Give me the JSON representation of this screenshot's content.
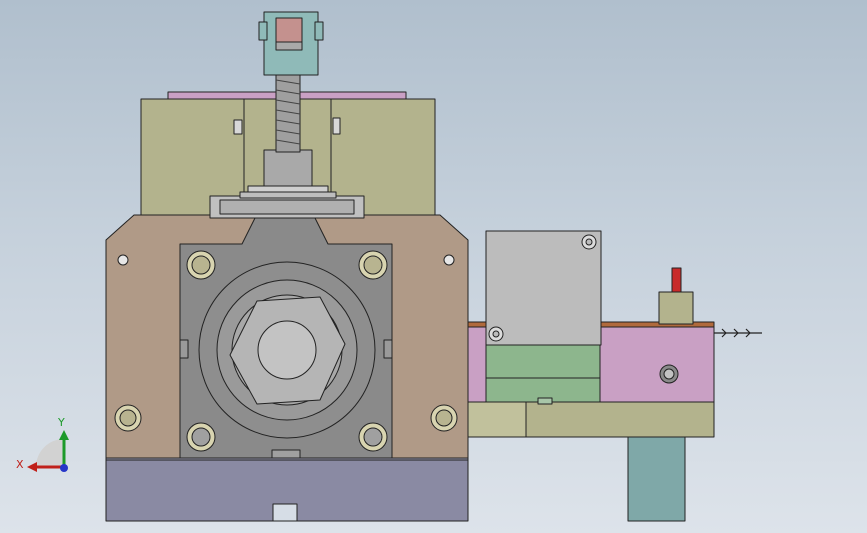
{
  "viewport": {
    "background_top": "#b0bfcd",
    "background_bottom": "#dde3ea"
  },
  "triad": {
    "x_label": "X",
    "y_label": "Y",
    "x_color": "#c0201a",
    "y_color": "#1c9a2a",
    "z_color": "#2536c8"
  },
  "colors": {
    "tan_body": "#b09a87",
    "steel_gray": "#8a8a8a",
    "olive_block": "#b3b38d",
    "pink_plate": "#c9a0c4",
    "green_block": "#8db68d",
    "cylinder_teal": "#7fa8a8",
    "base_slate": "#8a8aa3",
    "light_gray_box": "#bcbcbc",
    "rust_strip": "#b06a3c",
    "red_pin": "#c82a2a"
  }
}
